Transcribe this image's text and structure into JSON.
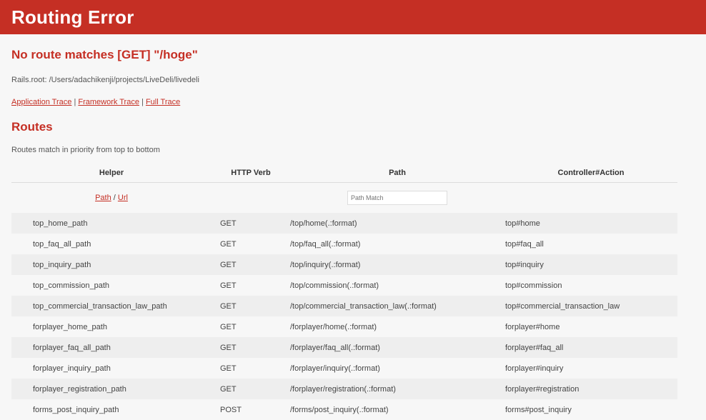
{
  "banner": {
    "title": "Routing Error"
  },
  "error": {
    "message": "No route matches [GET] \"/hoge\""
  },
  "rails_root": "Rails.root: /Users/adachikenji/projects/LiveDeli/livedeli",
  "trace_links": [
    {
      "label": "Application Trace"
    },
    {
      "label": "Framework Trace"
    },
    {
      "label": "Full Trace"
    }
  ],
  "trace_separator": " | ",
  "routes": {
    "heading": "Routes",
    "description": "Routes match in priority from top to bottom",
    "columns": [
      "Helper",
      "HTTP Verb",
      "Path",
      "Controller#Action"
    ],
    "filter": {
      "path_label": "Path",
      "separator": " / ",
      "url_label": "Url",
      "search_placeholder": "Path Match"
    },
    "rows": [
      {
        "helper": "top_home_path",
        "verb": "GET",
        "path": "/top/home(.:format)",
        "action": "top#home"
      },
      {
        "helper": "top_faq_all_path",
        "verb": "GET",
        "path": "/top/faq_all(.:format)",
        "action": "top#faq_all"
      },
      {
        "helper": "top_inquiry_path",
        "verb": "GET",
        "path": "/top/inquiry(.:format)",
        "action": "top#inquiry"
      },
      {
        "helper": "top_commission_path",
        "verb": "GET",
        "path": "/top/commission(.:format)",
        "action": "top#commission"
      },
      {
        "helper": "top_commercial_transaction_law_path",
        "verb": "GET",
        "path": "/top/commercial_transaction_law(.:format)",
        "action": "top#commercial_transaction_law"
      },
      {
        "helper": "forplayer_home_path",
        "verb": "GET",
        "path": "/forplayer/home(.:format)",
        "action": "forplayer#home"
      },
      {
        "helper": "forplayer_faq_all_path",
        "verb": "GET",
        "path": "/forplayer/faq_all(.:format)",
        "action": "forplayer#faq_all"
      },
      {
        "helper": "forplayer_inquiry_path",
        "verb": "GET",
        "path": "/forplayer/inquiry(.:format)",
        "action": "forplayer#inquiry"
      },
      {
        "helper": "forplayer_registration_path",
        "verb": "GET",
        "path": "/forplayer/registration(.:format)",
        "action": "forplayer#registration"
      },
      {
        "helper": "forms_post_inquiry_path",
        "verb": "POST",
        "path": "/forms/post_inquiry(.:format)",
        "action": "forms#post_inquiry"
      }
    ]
  },
  "colors": {
    "accent": "#c52f24",
    "background": "#f7f7f7",
    "row_alt": "#eeeeee"
  }
}
